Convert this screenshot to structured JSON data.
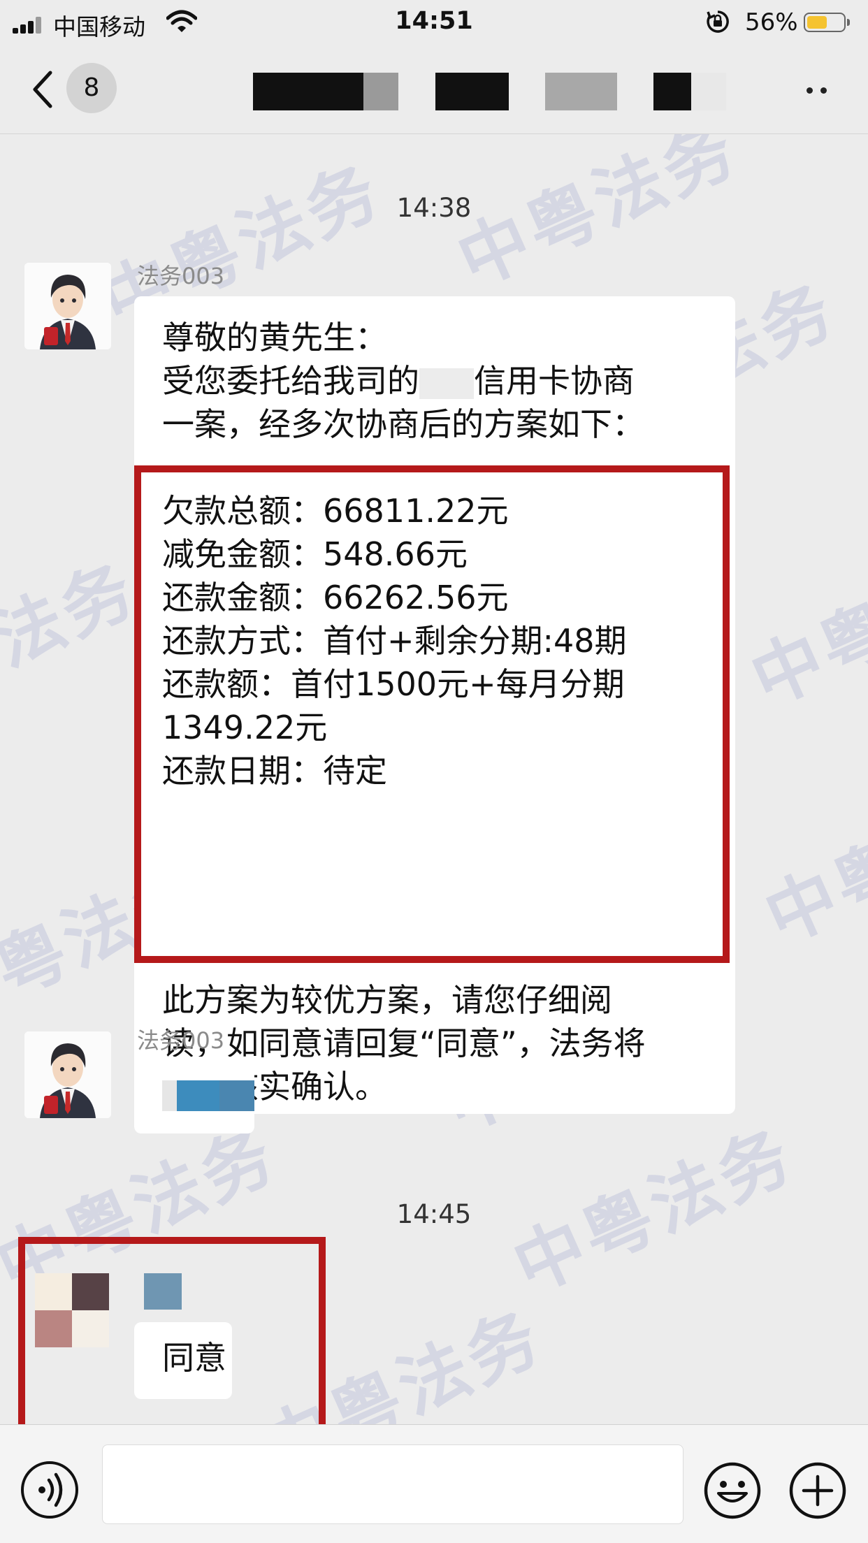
{
  "status_bar": {
    "carrier": "中国移动",
    "time": "14:51",
    "battery_percent": "56%",
    "battery_level": 0.56,
    "battery_color": "#f5c330"
  },
  "nav": {
    "unread_count": "8",
    "back_icon": "chevron-left-icon",
    "more_icon": "more-dots-icon"
  },
  "chat": {
    "watermark": "中粤法务",
    "timestamp_1": "14:38",
    "msg1": {
      "sender": "法务003",
      "intro_lines": [
        "尊敬的黄先生：",
        "受您委托给我司的",
        "信用卡协商",
        "一案，经多次协商后的方案如下："
      ],
      "plan_lines": [
        "欠款总额：66811.22元",
        "减免金额：548.66元",
        "还款金额：66262.56元",
        "还款方式：首付+剩余分期:48期",
        "还款额：首付1500元+每月分期",
        "1349.22元",
        "还款日期：待定"
      ],
      "closing_lines": [
        "此方案为较优方案，请您仔细阅",
        "读，如同意请回复“同意”，法务将",
        "为您核实确认。"
      ]
    },
    "msg2": {
      "sender": "法务003"
    },
    "timestamp_2": "14:45",
    "msg3": {
      "text": "同意"
    },
    "highlight_color": "#b5191a"
  },
  "input_bar": {
    "voice_icon": "voice-icon",
    "emoji_icon": "emoji-icon",
    "plus_icon": "plus-icon"
  }
}
